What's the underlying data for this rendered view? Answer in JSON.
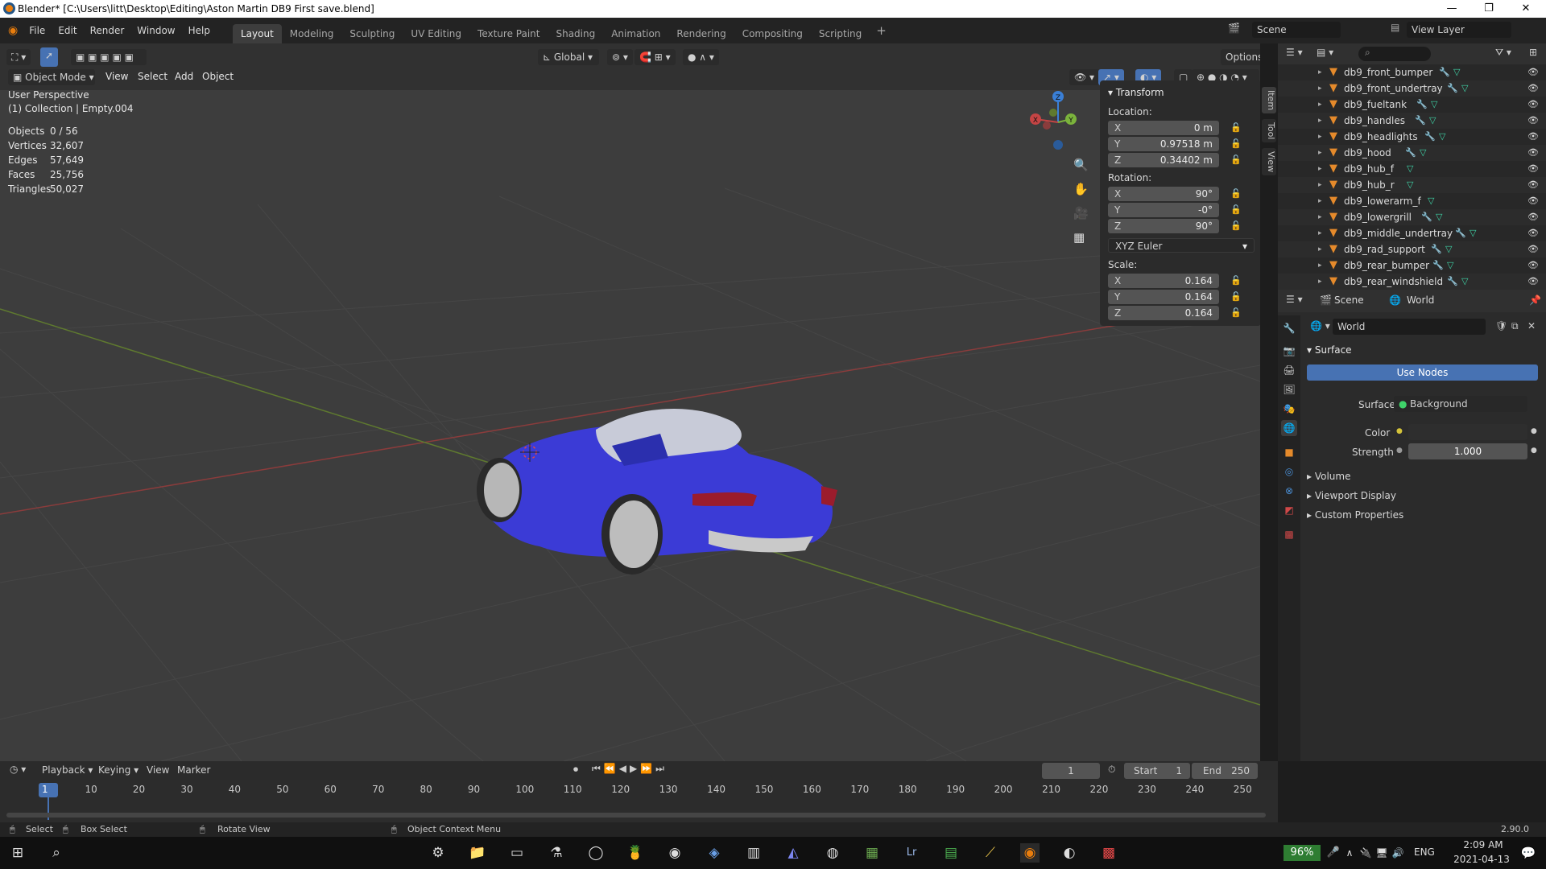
{
  "title_bar": {
    "text": "Blender* [C:\\Users\\litt\\Desktop\\Editing\\Aston Martin DB9 First save.blend]"
  },
  "menubar": {
    "menus": [
      "File",
      "Edit",
      "Render",
      "Window",
      "Help"
    ],
    "workspaces": [
      "Layout",
      "Modeling",
      "Sculpting",
      "UV Editing",
      "Texture Paint",
      "Shading",
      "Animation",
      "Rendering",
      "Compositing",
      "Scripting"
    ],
    "active_workspace": "Layout",
    "scene": "Scene",
    "view_layer": "View Layer"
  },
  "viewport": {
    "orientation": "Global",
    "options_label": "Options",
    "mode": "Object Mode",
    "menus": [
      "View",
      "Select",
      "Add",
      "Object"
    ],
    "perspective": "User Perspective",
    "collection_info": "(1) Collection | Empty.004",
    "stats": [
      {
        "label": "Objects",
        "value": "0 / 56"
      },
      {
        "label": "Vertices",
        "value": "32,607"
      },
      {
        "label": "Edges",
        "value": "57,649"
      },
      {
        "label": "Faces",
        "value": "25,756"
      },
      {
        "label": "Triangles",
        "value": "50,027"
      }
    ],
    "gizmo_axes": {
      "x": "X",
      "y": "Y",
      "z": "Z"
    }
  },
  "transform_panel": {
    "title": "Transform",
    "location_label": "Location:",
    "location": [
      {
        "axis": "X",
        "value": "0 m"
      },
      {
        "axis": "Y",
        "value": "0.97518 m"
      },
      {
        "axis": "Z",
        "value": "0.34402 m"
      }
    ],
    "rotation_label": "Rotation:",
    "rotation": [
      {
        "axis": "X",
        "value": "90°"
      },
      {
        "axis": "Y",
        "value": "-0°"
      },
      {
        "axis": "Z",
        "value": "90°"
      }
    ],
    "rotation_mode": "XYZ Euler",
    "scale_label": "Scale:",
    "scale": [
      {
        "axis": "X",
        "value": "0.164"
      },
      {
        "axis": "Y",
        "value": "0.164"
      },
      {
        "axis": "Z",
        "value": "0.164"
      }
    ],
    "side_tabs": [
      "Item",
      "Tool",
      "View"
    ]
  },
  "outliner": {
    "items": [
      "db9_front_bumper",
      "db9_front_undertray",
      "db9_fueltank",
      "db9_handles",
      "db9_headlights",
      "db9_hood",
      "db9_hub_f",
      "db9_hub_r",
      "db9_lowerarm_f",
      "db9_lowergrill",
      "db9_middle_undertray",
      "db9_rad_support",
      "db9_rear_bumper",
      "db9_rear_windshield"
    ]
  },
  "properties": {
    "context_scene": "Scene",
    "context_world": "World",
    "world_name": "World",
    "surface_section": "Surface",
    "use_nodes": "Use Nodes",
    "surface_label": "Surface",
    "surface_value": "Background",
    "color_label": "Color",
    "strength_label": "Strength",
    "strength_value": "1.000",
    "sections": [
      "Volume",
      "Viewport Display",
      "Custom Properties"
    ]
  },
  "timeline": {
    "menus": [
      "Playback",
      "Keying",
      "View",
      "Marker"
    ],
    "current_frame": "1",
    "start_label": "Start",
    "start": "1",
    "end_label": "End",
    "end": "250",
    "ticks": [
      "1",
      "10",
      "20",
      "30",
      "40",
      "50",
      "60",
      "70",
      "80",
      "90",
      "100",
      "110",
      "120",
      "130",
      "140",
      "150",
      "160",
      "170",
      "180",
      "190",
      "200",
      "210",
      "220",
      "230",
      "240",
      "250"
    ]
  },
  "statusbar": {
    "select": "Select",
    "box_select": "Box Select",
    "rotate_view": "Rotate View",
    "context_menu": "Object Context Menu",
    "version": "2.90.0"
  },
  "taskbar": {
    "battery": "96%",
    "language": "ENG",
    "time": "2:09 AM",
    "date": "2021-04-13"
  },
  "colors": {
    "accent": "#4772b3",
    "car_body": "#3b3bd6",
    "x_axis": "#c44444",
    "y_axis": "#7bb33c",
    "z_axis": "#3a7fd6"
  }
}
